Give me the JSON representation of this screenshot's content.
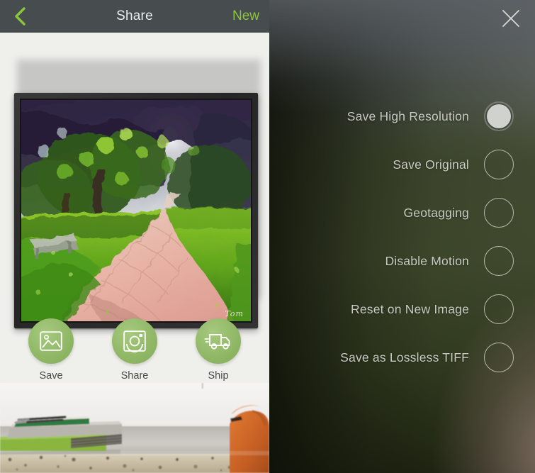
{
  "left": {
    "topbar": {
      "back_icon": "chevron-left-icon",
      "title": "Share",
      "new_label": "New",
      "bg_color": "#474c4e",
      "accent_color": "#8cc63e",
      "title_color": "#e9ecec"
    },
    "artwork": {
      "signature": "Tom",
      "frame_color": "#2c2c2c",
      "background_color": "#efefec"
    },
    "actions": [
      {
        "label": "Save",
        "icon": "photo-icon",
        "color": "#8fb765"
      },
      {
        "label": "Share",
        "icon": "camera-icon",
        "color": "#8fb765"
      },
      {
        "label": "Ship",
        "icon": "truck-icon",
        "color": "#8fb765"
      }
    ]
  },
  "right": {
    "close_icon": "close-icon",
    "options": [
      {
        "label": "Save High Resolution",
        "state": "on"
      },
      {
        "label": "Save Original",
        "state": "off"
      },
      {
        "label": "Geotagging",
        "state": "off"
      },
      {
        "label": "Disable Motion",
        "state": "off"
      },
      {
        "label": "Reset on New Image",
        "state": "off"
      },
      {
        "label": "Save as Lossless TIFF",
        "state": "off"
      }
    ],
    "label_color": "#c8cbc3"
  }
}
